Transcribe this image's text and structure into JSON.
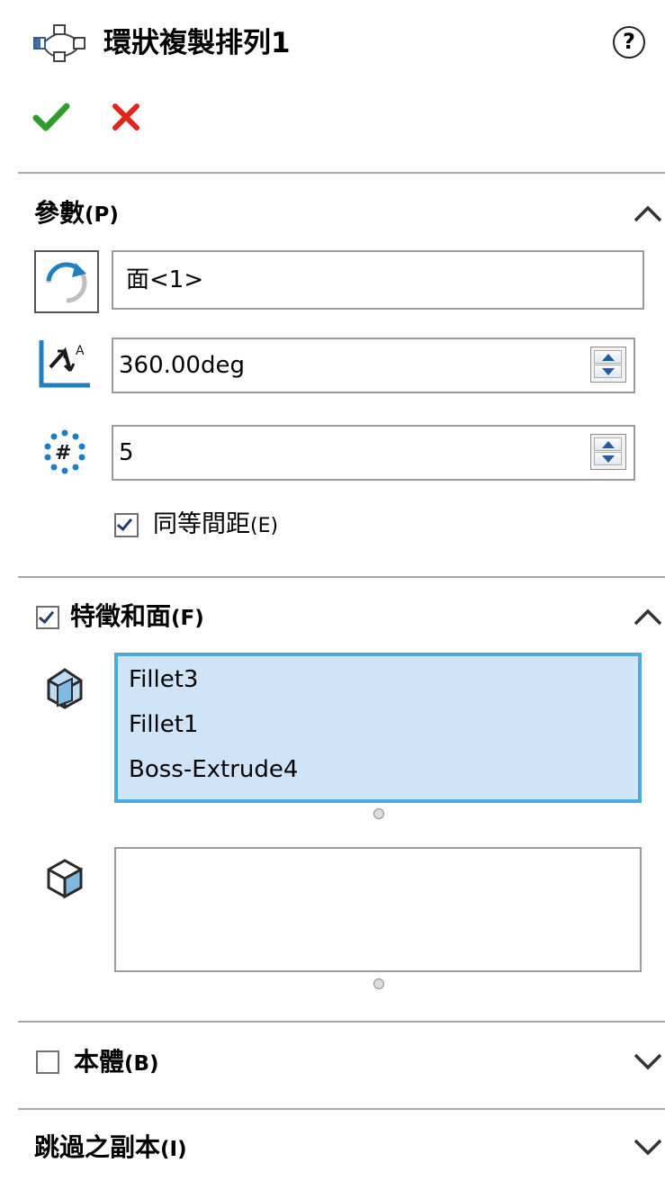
{
  "header": {
    "title": "環狀複製排列1",
    "help_label": "?",
    "icon": "circular-pattern-icon",
    "ok_icon": "checkmark-icon",
    "cancel_icon": "x-icon",
    "ok_color": "#2e9d2e",
    "cancel_color": "#e0261c"
  },
  "parameters": {
    "title": "參數",
    "shortcut": "(P)",
    "expanded": true,
    "axis_icon": "rotate-direction-icon",
    "axis_value": "面<1>",
    "angle_icon": "angle-icon",
    "angle_value": "360.00deg",
    "instances_icon": "instances-icon",
    "instances_value": "5",
    "equal_spacing": {
      "label": "同等間距",
      "shortcut": "(E)",
      "checked": true
    }
  },
  "features_faces": {
    "title": "特徵和面",
    "shortcut": "(F)",
    "checked": true,
    "expanded": true,
    "features_icon": "features-to-pattern-icon",
    "features": [
      "Fillet3",
      "Fillet1",
      "Boss-Extrude4"
    ],
    "faces_icon": "faces-to-pattern-icon",
    "faces": []
  },
  "bodies": {
    "title": "本體",
    "shortcut": "(B)",
    "checked": false,
    "expanded": false
  },
  "skip_instances": {
    "title": "跳過之副本",
    "shortcut": "(I)",
    "expanded": false
  },
  "colors": {
    "accent": "#1f7fc0",
    "selection_fill": "#cfe5f7",
    "selection_border": "#4aaad9"
  }
}
